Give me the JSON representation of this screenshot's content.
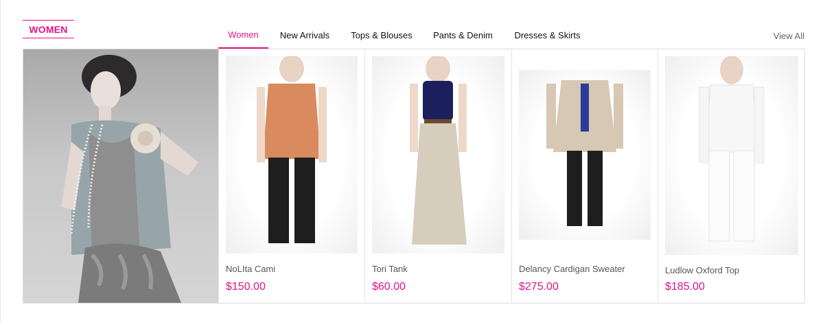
{
  "section": {
    "title": "WOMEN"
  },
  "tabs": [
    {
      "label": "Women",
      "active": true
    },
    {
      "label": "New Arrivals",
      "active": false
    },
    {
      "label": "Tops & Blouses",
      "active": false
    },
    {
      "label": "Pants & Denim",
      "active": false
    },
    {
      "label": "Dresses & Skirts",
      "active": false
    }
  ],
  "view_all": "View All",
  "products": [
    {
      "name": "NoLIta Cami",
      "price": "$150.00"
    },
    {
      "name": "Tori Tank",
      "price": "$60.00"
    },
    {
      "name": "Delancy Cardigan Sweater",
      "price": "$275.00"
    },
    {
      "name": "Ludlow Oxford Top",
      "price": "$185.00"
    }
  ],
  "colors": {
    "accent": "#e2138c",
    "border": "#dcdcdc"
  }
}
